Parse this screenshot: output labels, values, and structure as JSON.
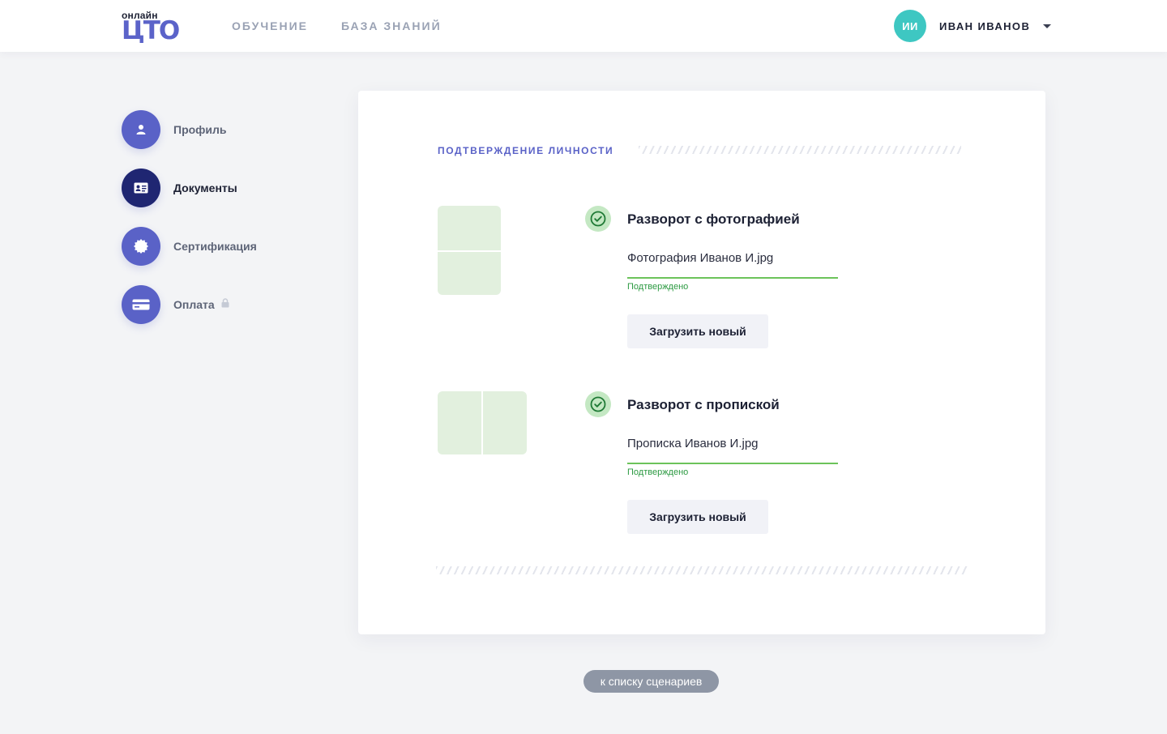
{
  "header": {
    "logo_small": "онлайн",
    "logo_main": "ЦТО",
    "nav": [
      {
        "label": "ОБУЧЕНИЕ"
      },
      {
        "label": "БАЗА ЗНАНИЙ"
      }
    ],
    "user": {
      "initials": "ИИ",
      "name": "ИВАН ИВАНОВ",
      "dropdown_icon": "caret-down-icon"
    }
  },
  "sidebar": {
    "items": [
      {
        "label": "Профиль",
        "icon": "user-icon",
        "active": false
      },
      {
        "label": "Документы",
        "icon": "id-card-icon",
        "active": true
      },
      {
        "label": "Сертификация",
        "icon": "badge-icon",
        "active": false
      },
      {
        "label": "Оплата",
        "icon": "credit-card-icon",
        "active": false,
        "locked": true,
        "lock_icon": "lock-icon"
      }
    ]
  },
  "main": {
    "section_title": "ПОДТВЕРЖДЕНИЕ ЛИЧНОСТИ",
    "documents": [
      {
        "title": "Разворот с фотографией",
        "file_name": "Фотография Иванов И.jpg",
        "status": "Подтверждено",
        "button": "Загрузить новый",
        "status_icon": "check-circle-icon"
      },
      {
        "title": "Разворот с пропиской",
        "file_name": "Прописка Иванов И.jpg",
        "status": "Подтверждено",
        "button": "Загрузить новый",
        "status_icon": "check-circle-icon"
      }
    ]
  },
  "footer": {
    "back_link": "к списку сценариев"
  },
  "colors": {
    "accent": "#5a62c7",
    "active_nav": "#1f2672",
    "avatar": "#3ec7c2",
    "success": "#2c9a42",
    "success_line": "#6cc35a",
    "thumb": "#e2f0de",
    "background": "#f3f4f6"
  }
}
